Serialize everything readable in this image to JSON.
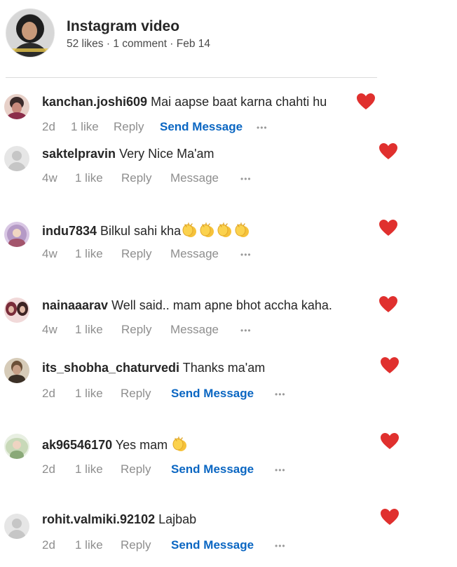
{
  "post": {
    "title": "Instagram video",
    "meta": "52 likes · 1 comment · Feb 14"
  },
  "colors": {
    "heart": "#e0302e",
    "send_message": "#0a66c2",
    "muted": "#8e8e8e"
  },
  "comments": [
    {
      "user": "kanchan.joshi609",
      "text": "Mai aapse baat karna chahti hu",
      "emoji_count": 0,
      "time": "2d",
      "likes": "1 like",
      "reply": "Reply",
      "action": "Send Message",
      "more": "•••",
      "liked": true
    },
    {
      "user": "saktelpravin",
      "text": "Very Nice Ma'am",
      "emoji_count": 0,
      "time": "4w",
      "likes": "1 like",
      "reply": "Reply",
      "action": "Message",
      "more": "•••",
      "liked": true
    },
    {
      "user": "indu7834",
      "text": "Bilkul sahi kha",
      "emoji_count": 4,
      "time": "4w",
      "likes": "1 like",
      "reply": "Reply",
      "action": "Message",
      "more": "•••",
      "liked": true
    },
    {
      "user": "nainaaarav",
      "text": "Well said.. mam apne bhot accha kaha.",
      "emoji_count": 0,
      "time": "4w",
      "likes": "1 like",
      "reply": "Reply",
      "action": "Message",
      "more": "•••",
      "liked": true
    },
    {
      "user": "its_shobha_chaturvedi",
      "text": "Thanks ma'am",
      "emoji_count": 0,
      "time": "2d",
      "likes": "1 like",
      "reply": "Reply",
      "action": "Send Message",
      "more": "•••",
      "liked": true
    },
    {
      "user": "ak96546170",
      "text": "Yes mam",
      "emoji_count": 1,
      "time": "2d",
      "likes": "1 like",
      "reply": "Reply",
      "action": "Send Message",
      "more": "•••",
      "liked": true
    },
    {
      "user": "rohit.valmiki.92102",
      "text": "Lajbab",
      "emoji_count": 0,
      "time": "2d",
      "likes": "1 like",
      "reply": "Reply",
      "action": "Send Message",
      "more": "•••",
      "liked": true
    }
  ]
}
